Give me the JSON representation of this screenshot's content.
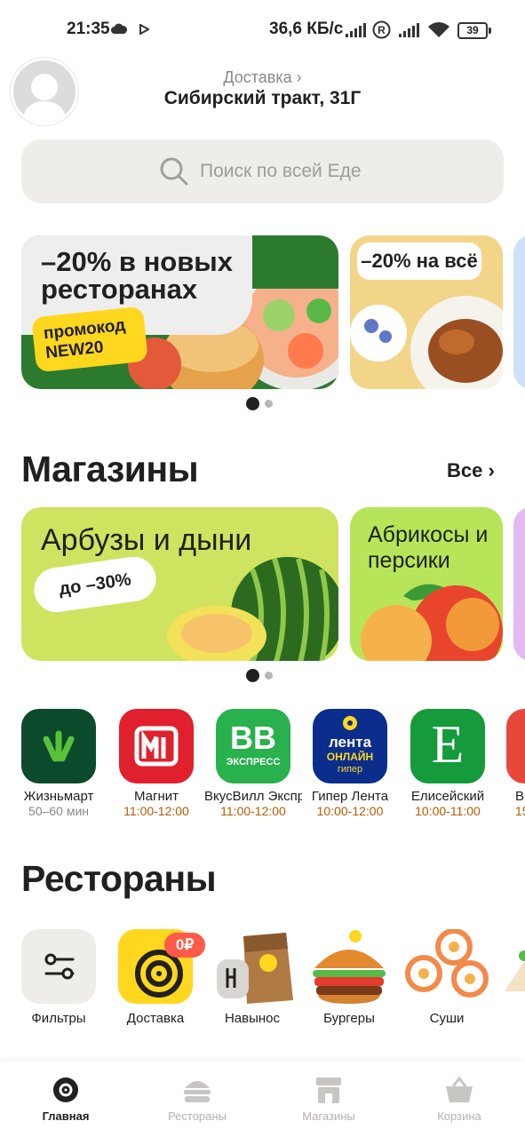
{
  "status_bar": {
    "time": "21:35",
    "network_speed": "36,6 КБ/с",
    "battery": "39"
  },
  "header": {
    "delivery_label": "Доставка",
    "address": "Сибирский тракт, 31Г"
  },
  "search": {
    "placeholder": "Поиск по всей Еде"
  },
  "promos": {
    "banner1_title": "–20% в новых ресторанах",
    "banner1_promo_line1": "промокод",
    "banner1_promo_line2": "NEW20",
    "banner2_title": "–20% на всё"
  },
  "shops_section": {
    "title": "Магазины",
    "all_label": "Все",
    "banner1_title": "Арбузы и дыни",
    "banner1_badge": "до –30%",
    "banner2_title": "Абрикосы и персики"
  },
  "stores": [
    {
      "name": "Жизньмарт",
      "hours": "50–60 мин"
    },
    {
      "name": "Магнит",
      "hours": "11:00-12:00"
    },
    {
      "name": "ВкусВилл Экспресс",
      "hours": "11:00-12:00"
    },
    {
      "name": "Гипер Лента",
      "hours": "10:00-12:00"
    },
    {
      "name": "Елисейский",
      "hours": "10:00-11:00"
    },
    {
      "name": "В",
      "hours": "15"
    }
  ],
  "store_logos": {
    "vv": "ВВ",
    "vv_sub": "ЭКСПРЕСС",
    "lenta1": "лента",
    "lenta2": "ОНЛАЙН",
    "lenta3": "гипер",
    "elis": "Е"
  },
  "restaurants_section": {
    "title": "Рестораны",
    "categories": [
      "Фильтры",
      "Доставка",
      "Навынос",
      "Бургеры",
      "Суши"
    ],
    "delivery_badge": "0₽"
  },
  "bottom_nav": {
    "items": [
      "Главная",
      "Рестораны",
      "Магазины",
      "Корзина"
    ],
    "active": "Главная"
  },
  "colors": {
    "accent_yellow": "#ffd71e",
    "text_primary": "#21201f",
    "hours_orange": "#b35c00"
  }
}
